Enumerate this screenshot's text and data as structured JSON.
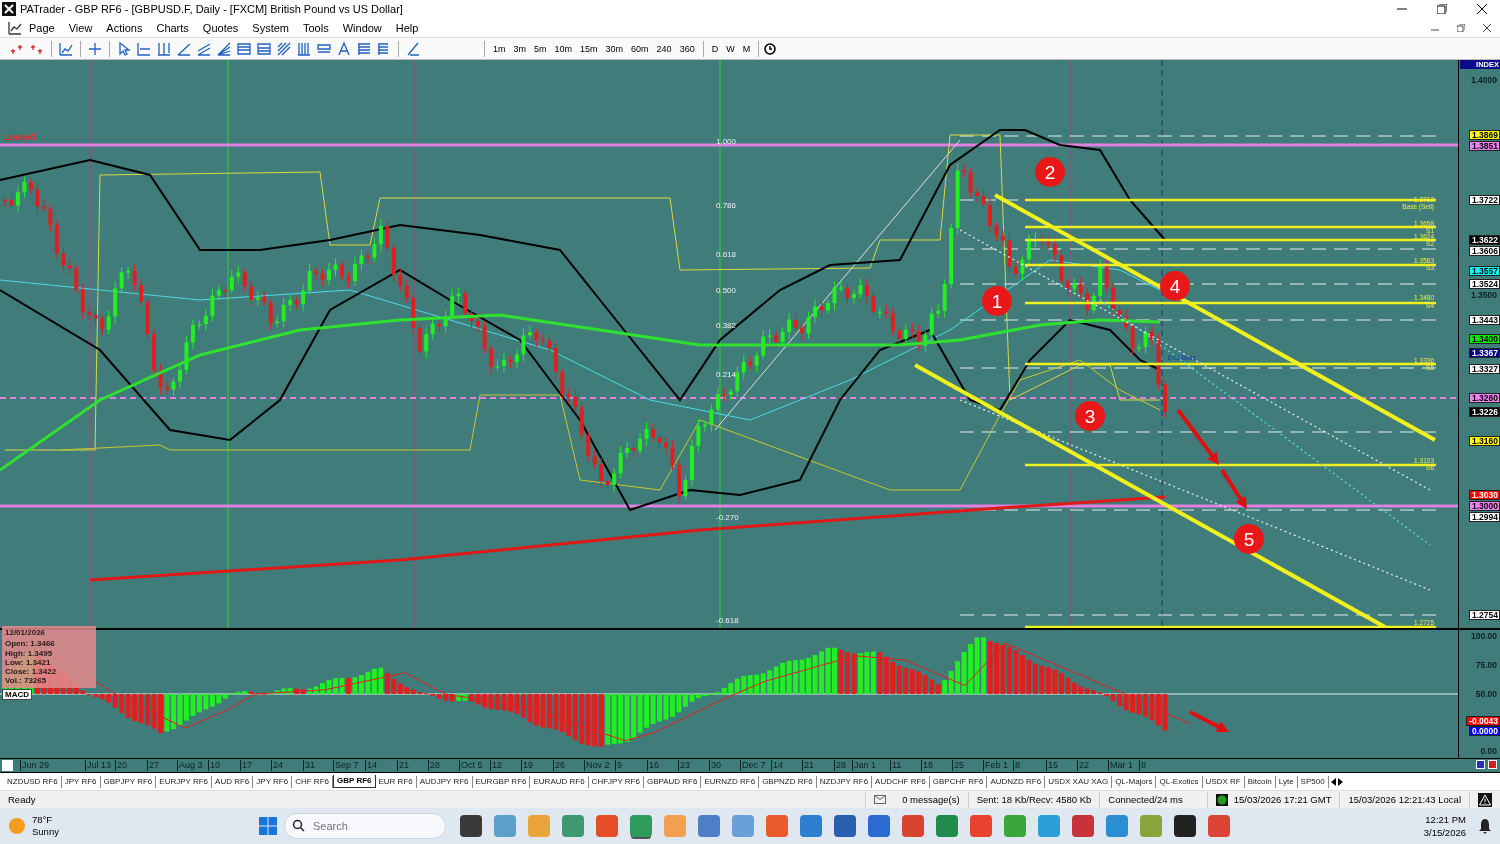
{
  "window": {
    "title": "PATrader - GBP RF6 - [GBPUSD.F, Daily - [FXCM] British Pound vs US Dollar]"
  },
  "menu": [
    "Page",
    "View",
    "Actions",
    "Charts",
    "Quotes",
    "System",
    "Tools",
    "Window",
    "Help"
  ],
  "toolbar": {
    "timeframes": [
      "1m",
      "3m",
      "5m",
      "10m",
      "15m",
      "30m",
      "60m",
      "240",
      "360",
      "D",
      "W",
      "M"
    ]
  },
  "chart": {
    "status": "Locked",
    "fib_levels": [
      "1.000",
      "0.786",
      "0.618",
      "0.500",
      "0.382",
      "0.214",
      "-0.270",
      "-0.618"
    ],
    "level_labels": [
      "1.3713",
      "Base (Sell)",
      "1.3658",
      "S1",
      "1.3624",
      "S2",
      "1.3563",
      "S3",
      "1.3480",
      "S4",
      "1.3336",
      "S5",
      "1.3103",
      "S6",
      "1.2725",
      "End Base"
    ],
    "markers": [
      "1",
      "2",
      "3",
      "4",
      "5"
    ],
    "price_axis": {
      "header": "INDEX",
      "labels": [
        {
          "text": "1.4000",
          "kind": "plain"
        },
        {
          "text": "1.3869",
          "kind": "tag",
          "color": "#ffff00"
        },
        {
          "text": "1.3851",
          "kind": "tag",
          "color": "#ee82ee"
        },
        {
          "text": "1.3722",
          "kind": "tag",
          "color": "#ffffff"
        },
        {
          "text": "1.3622",
          "kind": "tag",
          "color": "#000000"
        },
        {
          "text": "1.3606",
          "kind": "tag",
          "color": "#ffffff"
        },
        {
          "text": "1.3557",
          "kind": "tag",
          "color": "#00ffff"
        },
        {
          "text": "1.3524",
          "kind": "tag",
          "color": "#ffffff"
        },
        {
          "text": "1.3500",
          "kind": "plain"
        },
        {
          "text": "1.3443",
          "kind": "tag",
          "color": "#ffffff"
        },
        {
          "text": "1.3400",
          "kind": "tag",
          "color": "#00ee00"
        },
        {
          "text": "1.3367",
          "kind": "tag",
          "color": "#000080"
        },
        {
          "text": "1.3327",
          "kind": "tag",
          "color": "#ffffff"
        },
        {
          "text": "1.3260",
          "kind": "tag",
          "color": "#ee82ee"
        },
        {
          "text": "1.3226",
          "kind": "tag",
          "color": "#000000"
        },
        {
          "text": "1.3160",
          "kind": "tag",
          "color": "#ffff00"
        },
        {
          "text": "1.3030",
          "kind": "tag",
          "color": "#ff0000"
        },
        {
          "text": "1.3000",
          "kind": "tag",
          "color": "#ee82ee"
        },
        {
          "text": "1.2994",
          "kind": "tag",
          "color": "#ffffff"
        },
        {
          "text": "1.2754",
          "kind": "tag",
          "color": "#ffffff"
        }
      ]
    },
    "info_box": {
      "date": "12/01/2026",
      "lines": [
        "Open: 1.3466",
        "High: 1.3495",
        "Low: 1.3421",
        "Close: 1.3422",
        "Vol.: 73265"
      ]
    },
    "indicator": {
      "name": "MACD",
      "axis": [
        {
          "text": "100.00",
          "kind": "plain"
        },
        {
          "text": "75.00",
          "kind": "plain"
        },
        {
          "text": "50.00",
          "kind": "plain"
        },
        {
          "text": "-0.0043",
          "kind": "tag",
          "color": "#ff0000"
        },
        {
          "text": "0.0000",
          "kind": "tag",
          "color": "#0000ff"
        },
        {
          "text": "0.00",
          "kind": "plain"
        }
      ]
    },
    "date_axis": [
      "Jun 29",
      "Jul 13",
      "20",
      "27",
      "Aug 3",
      "10",
      "17",
      "24",
      "31",
      "Sep 7",
      "14",
      "21",
      "28",
      "Oct 5",
      "12",
      "19",
      "26",
      "Nov 2",
      "9",
      "16",
      "23",
      "30",
      "Dec 7",
      "14",
      "21",
      "28",
      "Jan 1",
      "11",
      "18",
      "25",
      "Feb 1",
      "8",
      "15",
      "22",
      "Mar 1",
      "8"
    ]
  },
  "symbol_tabs": [
    {
      "label": "NZDUSD RF6",
      "selected": false
    },
    {
      "label": "JPY RF6",
      "selected": false
    },
    {
      "label": "GBPJPY RF6",
      "selected": false
    },
    {
      "label": "EURJPY RF6",
      "selected": false
    },
    {
      "label": "AUD RF6",
      "selected": false
    },
    {
      "label": "JPY RF6",
      "selected": false
    },
    {
      "label": "CHF RF6",
      "selected": false
    },
    {
      "label": "GBP RF6",
      "selected": true
    },
    {
      "label": "EUR RF6",
      "selected": false
    },
    {
      "label": "AUDJPY RF6",
      "selected": false
    },
    {
      "label": "EURGBP RF6",
      "selected": false
    },
    {
      "label": "EURAUD RF6",
      "selected": false
    },
    {
      "label": "CHFJPY RF6",
      "selected": false
    },
    {
      "label": "GBPAUD RF6",
      "selected": false
    },
    {
      "label": "EURNZD RF6",
      "selected": false
    },
    {
      "label": "GBPNZD RF6",
      "selected": false
    },
    {
      "label": "NZDJPY RF6",
      "selected": false
    },
    {
      "label": "AUDCHF RF6",
      "selected": false
    },
    {
      "label": "GBPCHF RF6",
      "selected": false
    },
    {
      "label": "AUDNZD RF6",
      "selected": false
    },
    {
      "label": "USDX XAU XAG",
      "selected": false
    },
    {
      "label": "QL-Majors",
      "selected": false
    },
    {
      "label": "QL-Exotics",
      "selected": false
    },
    {
      "label": "USDX RF",
      "selected": false
    },
    {
      "label": "Bitcoin",
      "selected": false
    },
    {
      "label": "Lyte",
      "selected": false
    },
    {
      "label": "SP500",
      "selected": false
    }
  ],
  "status_bar": {
    "state": "Ready",
    "messages": "0 message(s)",
    "traffic": "Sent: 18 Kb/Recv: 4580 Kb",
    "connection": "Connected/24 ms",
    "server_time": "15/03/2026 17:21 GMT",
    "local_time": "15/03/2026 12:21:43 Local"
  },
  "taskbar": {
    "temperature": "78°F",
    "weather": "Sunny",
    "search_placeholder": "Search",
    "time": "12:21 PM",
    "date": "3/15/2026"
  }
}
